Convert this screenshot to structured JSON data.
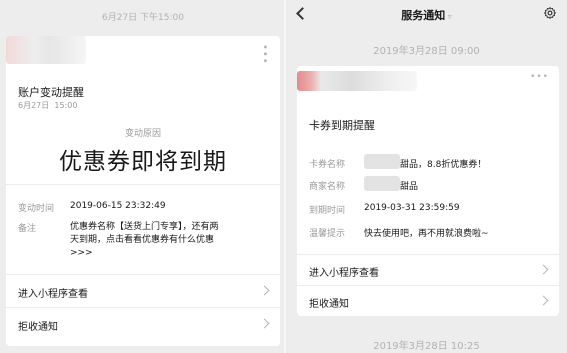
{
  "left": {
    "timestamp": "6月27日 下午15:00",
    "card": {
      "title": "账户变动提醒",
      "date": "6月27日",
      "time": "15:00",
      "reason_label": "变动原因",
      "headline": "优惠券即将到期",
      "change_time_label": "变动时间",
      "change_time_value": "2019-06-15 23:32:49",
      "note_label": "备注",
      "note_line1": "优惠券名称【送货上门专享】，还有两",
      "note_line2": "天到期，点击看看优惠券有什么优惠",
      "note_line3": ">>>",
      "action_enter": "进入小程序查看",
      "action_reject": "拒收通知"
    }
  },
  "right": {
    "header_title": "服务通知",
    "timestamp_top": "2019年3月28日 09:00",
    "timestamp_bottom": "2019年3月28日 10:25",
    "card": {
      "title": "卡券到期提醒",
      "rows": [
        {
          "label": "卡券名称",
          "value": "甜品，8.8折优惠券！"
        },
        {
          "label": "商家名称",
          "value": "甜品"
        },
        {
          "label": "到期时间",
          "value": "2019-03-31 23:59:59"
        },
        {
          "label": "温馨提示",
          "value": "快去使用吧，再不用就浪费啦~"
        }
      ],
      "action_enter": "进入小程序查看",
      "action_reject": "拒收通知"
    }
  },
  "icons": {
    "back": "chevron-left-icon",
    "settings": "gear-icon",
    "more": "more-dots-icon",
    "row_arrow": "chevron-right-icon"
  },
  "colors": {
    "background": "#ededed",
    "card": "#ffffff",
    "muted_text": "#9a9a9a",
    "timestamp": "#b2b2b2"
  }
}
